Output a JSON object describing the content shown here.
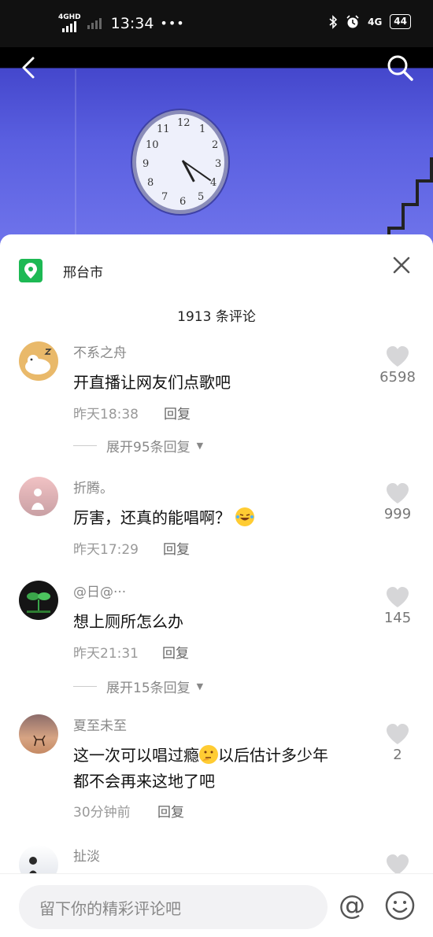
{
  "status_bar": {
    "network_label": "4GHD",
    "time": "13:34",
    "dots": "•••",
    "net_right": "4G",
    "battery": "44"
  },
  "header": {
    "back_icon": "back-arrow-icon",
    "search_icon": "search-icon"
  },
  "sheet": {
    "location": "邢台市",
    "comment_count_title": "1913 条评论",
    "comments": [
      {
        "name": "不系之舟",
        "text": "开直播让网友们点歌吧",
        "time": "昨天18:38",
        "reply": "回复",
        "likes": "6598",
        "expand": "展开95条回复"
      },
      {
        "name": "折腾。",
        "text": "厉害，还真的能唱啊？",
        "time": "昨天17:29",
        "reply": "回复",
        "likes": "999"
      },
      {
        "name": "@日@···",
        "text": "想上厕所怎么办",
        "time": "昨天21:31",
        "reply": "回复",
        "likes": "145",
        "expand": "展开15条回复"
      },
      {
        "name": "夏至未至",
        "text_line1_a": "这一次可以唱过瘾",
        "text_line1_b": "以后估计多少年",
        "text_line2": "都不会再来这地了吧",
        "time": "30分钟前",
        "reply": "回复",
        "likes": "2"
      },
      {
        "name": "扯淡"
      }
    ]
  },
  "input_bar": {
    "placeholder": "留下你的精彩评论吧",
    "at_label": "@"
  },
  "colors": {
    "location_green": "#1db954",
    "video_blue": "#5a5fe0"
  }
}
